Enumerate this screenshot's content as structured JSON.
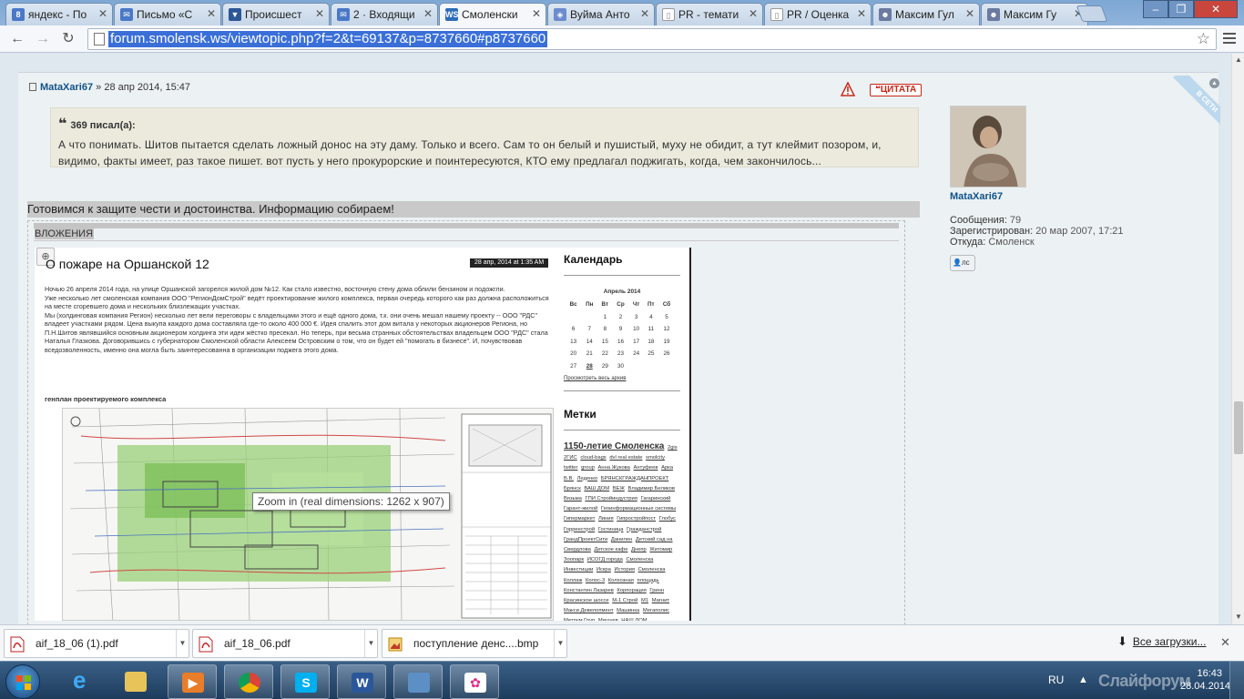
{
  "browser": {
    "tabs": [
      {
        "label": "яндекс - По",
        "icon_color": "#4a78c6",
        "icon": "8",
        "active": false
      },
      {
        "label": "Письмо «С",
        "icon_color": "#4a78c6",
        "icon": "✉",
        "active": false
      },
      {
        "label": "Происшест",
        "icon_color": "#2b5797",
        "icon": "▼",
        "active": false
      },
      {
        "label": "2 · Входящи",
        "icon_color": "#4a78c6",
        "icon": "✉",
        "active": false
      },
      {
        "label": "Смоленски",
        "icon_color": "#2d6db5",
        "icon": "WS",
        "active": true
      },
      {
        "label": "Вуйма Анто",
        "icon_color": "#6b8ccf",
        "icon": "◈",
        "active": false
      },
      {
        "label": "PR - темати",
        "icon_color": "#ffffff",
        "icon": "▯",
        "active": false
      },
      {
        "label": "PR / Оценка",
        "icon_color": "#ffffff",
        "icon": "▯",
        "active": false
      },
      {
        "label": "Максим Гул",
        "icon_color": "#6a7aa0",
        "icon": "☻",
        "active": false
      },
      {
        "label": "Максим Гу",
        "icon_color": "#6a7aa0",
        "icon": "☻",
        "active": false
      }
    ],
    "url": "forum.smolensk.ws/viewtopic.php?f=2&t=69137&p=8737660#p8737660"
  },
  "post": {
    "author": "MataXari67",
    "date": "» 28 апр 2014, 15:47",
    "quote_button": "ЦИТАТА",
    "quote": {
      "cite": "369 писал(а):",
      "text": "А что понимать. Шитов пытается сделать ложный донос на эту даму. Только и всего. Сам то он белый и пушистый, муху не обидит, а тут клеймит позором, и, видимо, факты имеет, раз такое пишет. вот пусть у него прокурорские и поинтересуются, КТО ему предлагал поджигать, когда, чем закончилось..."
    },
    "signature": "Готовимся к защите чести и достоинства. Информацию собираем!",
    "attachments_title": "ВЛОЖЕНИЯ",
    "attachment": {
      "article_title": "О пожаре на Оршанской 12",
      "article_date": "28 апр, 2014 at 1:35 AM",
      "article_paragraphs": [
        "Ночью 26 апреля 2014 года, на улице Оршанской загорелся жилой дом №12. Как стало известно, восточную стену дома облили бензином и подожгли.",
        "Уже несколько лет смоленская компания ООО \"РегионДомСтрой\" ведёт проектирование жилого комплекса, первая очередь которого как раз должна расположиться на месте сгоревшего дома и нескольких близлежащих участках.",
        "Мы (холдинговая компания Регион) несколько лет вели переговоры с владельцами этого и ещё одного дома, т.к. они очень мешал нашему проекту -- ООО \"РДС\" владеет участками рядом. Цена выкупа каждого дома составляла где-то около 400 000 €. Идея спалить этот дом витала у некоторых акционеров Региона, но П.Н.Шитов являвшийся основным акционером холдинга эти идеи жёстко пресекал. Но теперь, при весьма странных обстоятельствах владельцем ООО \"РДС\" стала Наталья Глазкова. Договорившись с губернатором Смоленской области Алексеем Островским о том, что он будет ей \"помогать в бизнесе\". И, почувствовав вседозволенность, именно она могла быть заинтересованна в организации поджега этого дома."
      ],
      "plan_caption": "генплан проектируемого комплекса",
      "zoom_tooltip": "Zoom in (real dimensions: 1262 x 907)",
      "calendar_heading": "Календарь",
      "calendar_month": "Апрель 2014",
      "calendar_weekdays": [
        "Вс",
        "Пн",
        "Вт",
        "Ср",
        "Чт",
        "Пт",
        "Сб"
      ],
      "calendar_weeks": [
        [
          "",
          "",
          "1",
          "2",
          "3",
          "4",
          "5"
        ],
        [
          "6",
          "7",
          "8",
          "9",
          "10",
          "11",
          "12"
        ],
        [
          "13",
          "14",
          "15",
          "16",
          "17",
          "18",
          "19"
        ],
        [
          "20",
          "21",
          "22",
          "23",
          "24",
          "25",
          "26"
        ],
        [
          "27",
          "28",
          "29",
          "30",
          "",
          "",
          ""
        ]
      ],
      "calendar_highlight": "28",
      "calendar_archive_link": "Просмотреть весь архив",
      "tags_heading": "Метки",
      "tags_big": "1150-летие Смоленска",
      "tags": [
        "2gis",
        "2ГИС",
        "cloud-bags",
        "dvl real estate",
        "smolcity",
        "twitter",
        "group",
        "Анна Жукова",
        "Антуфеев",
        "Арка",
        "В.В.",
        "Леденко",
        "БРЯНСКГРАЖДАНПРОЕКТ",
        "Брянск",
        "ВАШ ДОМ",
        "ВЕЖ",
        "Владимир Беликов",
        "Вязьма",
        "ГПИ Стройиндустрия",
        "Гагаринский",
        "Гарант-жилой",
        "Геоинформационные системы",
        "Гипермаркет",
        "Линия",
        "Гипростройпост",
        "Глобус",
        "Горреестрой",
        "Гостиница",
        "Гражданстрой",
        "ГрандПроектСити",
        "Данилен",
        "Детский сад на Свердлова",
        "Детское кафе",
        "Днепр",
        "Житомир",
        "Зоопарк",
        "ИСОГД города",
        "Смоленска",
        "Инвестиции",
        "Искра",
        "История",
        "Смоленска",
        "Коллаж",
        "Колос-3",
        "Колхозная",
        "площадь",
        "Константин Лазарев",
        "Корпорация",
        "Гринн",
        "Красинское шоссе",
        "М-1 Строй",
        "М1",
        "Магнит",
        "Макси Девелопмент",
        "Машинка",
        "Мегаполис",
        "Метрум Груп",
        "Мишуев",
        "НАШ ДОМ"
      ]
    }
  },
  "profile": {
    "name": "MataXari67",
    "online_badge": "В СЕТИ",
    "messages_label": "Сообщения:",
    "messages_value": "79",
    "registered_label": "Зарегистрирован:",
    "registered_value": "20 мар 2007, 17:21",
    "from_label": "Откуда:",
    "from_value": "Смоленск",
    "pm_button": "лс"
  },
  "downloads": {
    "items": [
      {
        "name": "aif_18_06 (1).pdf",
        "icon": "pdf-icon"
      },
      {
        "name": "aif_18_06.pdf",
        "icon": "pdf-icon"
      },
      {
        "name": "поступление денс....bmp",
        "icon": "image-icon"
      }
    ],
    "all_label": "Все загрузки..."
  },
  "taskbar": {
    "apps": [
      "folder-icon",
      "media-player-icon",
      "chrome-icon",
      "skype-icon",
      "word-icon",
      "photo-viewer-icon",
      "qip-icon"
    ],
    "language": "RU",
    "time": "16:43",
    "date": "28.04.2014",
    "watermark": "Слайфорум"
  },
  "colors": {
    "link_blue": "#105289",
    "quote_red": "#c7281a",
    "url_highlight": "#3a6fd8",
    "taskbar": "#1d3c5c"
  }
}
